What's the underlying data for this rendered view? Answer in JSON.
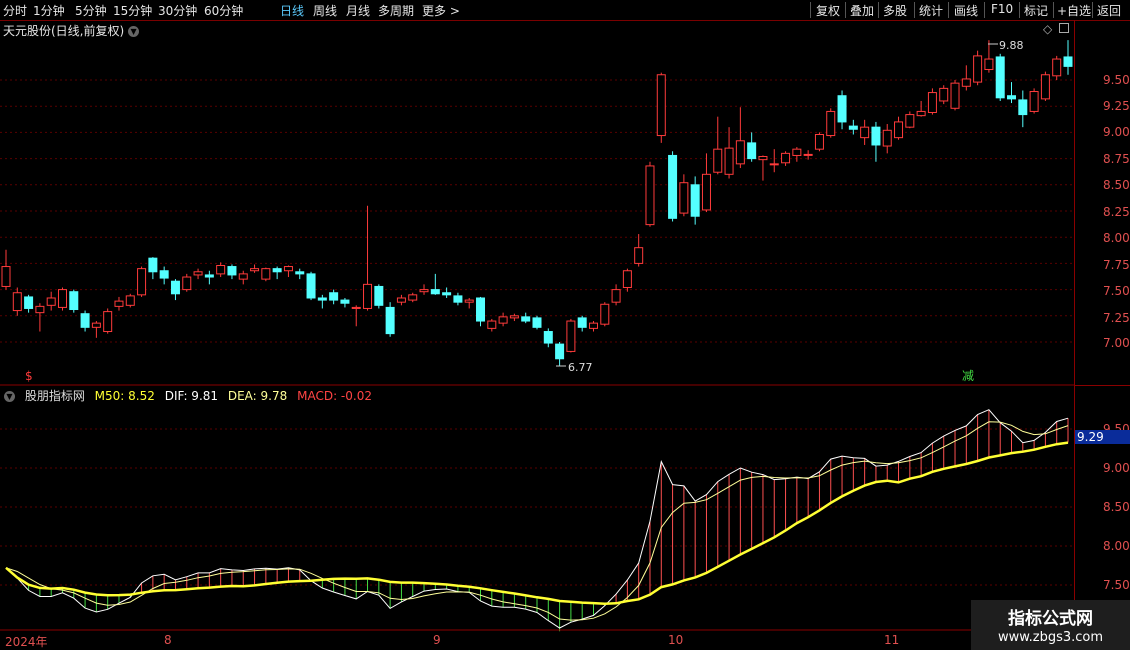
{
  "toolbar": {
    "periods": [
      "分时",
      "1分钟",
      "5分钟",
      "15分钟",
      "30分钟",
      "60分钟",
      "日线",
      "周线",
      "月线",
      "多周期",
      "更多 >"
    ],
    "active_period": "日线",
    "right_buttons": [
      "复权",
      "叠加",
      "多股",
      "统计",
      "画线",
      "F10",
      "标记",
      "+自选",
      "返回"
    ]
  },
  "main_chart": {
    "title": "天元股份(日线,前复权)",
    "high_label": "9.88",
    "low_label": "6.77",
    "marker_left": "$",
    "marker_right": "减",
    "price_axis": [
      "9.50",
      "9.25",
      "9.00",
      "8.75",
      "8.50",
      "8.25",
      "8.00",
      "7.75",
      "7.50",
      "7.25",
      "7.00"
    ]
  },
  "indicator": {
    "name": "股朋指标网",
    "m50_label": "M50: 8.52",
    "dif_label": "DIF: 9.81",
    "dea_label": "DEA: 9.78",
    "macd_label": "MACD: -0.02",
    "axis": [
      "9.50",
      "9.00",
      "8.50",
      "8.00",
      "7.50"
    ],
    "current_value": "9.29"
  },
  "date_axis": [
    "2024年",
    "8",
    "9",
    "10",
    "11"
  ],
  "watermark": {
    "title": "指标公式网",
    "url": "www.zbgs3.com"
  },
  "colors": {
    "up": "#ff3b3b",
    "down": "#54ffff",
    "m50": "#ffff33",
    "dif": "#ffffff",
    "dea": "#ffff99",
    "grid": "#7a0000"
  },
  "chart_data": {
    "type": "candlestick",
    "candles": [
      [
        7.53,
        7.72,
        7.88,
        7.5
      ],
      [
        7.3,
        7.47,
        7.52,
        7.25
      ],
      [
        7.43,
        7.32,
        7.45,
        7.28
      ],
      [
        7.28,
        7.34,
        7.37,
        7.1
      ],
      [
        7.35,
        7.42,
        7.48,
        7.3
      ],
      [
        7.33,
        7.5,
        7.52,
        7.3
      ],
      [
        7.48,
        7.31,
        7.5,
        7.28
      ],
      [
        7.27,
        7.14,
        7.3,
        7.1
      ],
      [
        7.14,
        7.18,
        7.2,
        7.04
      ],
      [
        7.1,
        7.29,
        7.32,
        7.08
      ],
      [
        7.34,
        7.39,
        7.43,
        7.3
      ],
      [
        7.35,
        7.44,
        7.46,
        7.33
      ],
      [
        7.45,
        7.7,
        7.72,
        7.43
      ],
      [
        7.8,
        7.67,
        7.81,
        7.6
      ],
      [
        7.68,
        7.61,
        7.72,
        7.55
      ],
      [
        7.58,
        7.46,
        7.6,
        7.4
      ],
      [
        7.5,
        7.62,
        7.65,
        7.48
      ],
      [
        7.64,
        7.67,
        7.7,
        7.6
      ],
      [
        7.64,
        7.62,
        7.68,
        7.55
      ],
      [
        7.65,
        7.73,
        7.76,
        7.62
      ],
      [
        7.72,
        7.64,
        7.74,
        7.6
      ],
      [
        7.6,
        7.65,
        7.68,
        7.55
      ],
      [
        7.68,
        7.7,
        7.74,
        7.66
      ],
      [
        7.6,
        7.7,
        7.71,
        7.58
      ],
      [
        7.7,
        7.67,
        7.72,
        7.6
      ],
      [
        7.68,
        7.72,
        7.73,
        7.62
      ],
      [
        7.67,
        7.65,
        7.7,
        7.6
      ],
      [
        7.65,
        7.42,
        7.67,
        7.4
      ],
      [
        7.42,
        7.4,
        7.45,
        7.32
      ],
      [
        7.47,
        7.4,
        7.5,
        7.36
      ],
      [
        7.4,
        7.37,
        7.42,
        7.33
      ],
      [
        7.32,
        7.33,
        7.35,
        7.15
      ],
      [
        7.32,
        7.55,
        8.3,
        7.3
      ],
      [
        7.53,
        7.35,
        7.55,
        7.32
      ],
      [
        7.33,
        7.08,
        7.38,
        7.05
      ],
      [
        7.38,
        7.42,
        7.45,
        7.35
      ],
      [
        7.4,
        7.45,
        7.47,
        7.38
      ],
      [
        7.48,
        7.5,
        7.55,
        7.45
      ],
      [
        7.5,
        7.46,
        7.65,
        7.45
      ],
      [
        7.47,
        7.45,
        7.52,
        7.42
      ],
      [
        7.44,
        7.38,
        7.47,
        7.35
      ],
      [
        7.38,
        7.4,
        7.42,
        7.32
      ],
      [
        7.42,
        7.2,
        7.43,
        7.15
      ],
      [
        7.13,
        7.2,
        7.22,
        7.1
      ],
      [
        7.18,
        7.24,
        7.28,
        7.15
      ],
      [
        7.23,
        7.25,
        7.27,
        7.2
      ],
      [
        7.24,
        7.2,
        7.28,
        7.18
      ],
      [
        7.23,
        7.14,
        7.25,
        7.12
      ],
      [
        7.1,
        6.99,
        7.13,
        6.95
      ],
      [
        6.98,
        6.84,
        7.0,
        6.77
      ],
      [
        6.91,
        7.2,
        7.22,
        6.9
      ],
      [
        7.23,
        7.14,
        7.25,
        7.1
      ],
      [
        7.13,
        7.18,
        7.2,
        7.1
      ],
      [
        7.17,
        7.36,
        7.38,
        7.15
      ],
      [
        7.38,
        7.5,
        7.55,
        7.35
      ],
      [
        7.52,
        7.68,
        7.7,
        7.48
      ],
      [
        7.75,
        7.9,
        8.03,
        7.72
      ],
      [
        8.12,
        8.68,
        8.72,
        8.1
      ],
      [
        8.97,
        9.55,
        9.57,
        8.9
      ],
      [
        8.78,
        8.18,
        8.82,
        8.15
      ],
      [
        8.23,
        8.52,
        8.6,
        8.2
      ],
      [
        8.5,
        8.2,
        8.58,
        8.12
      ],
      [
        8.26,
        8.6,
        8.8,
        8.24
      ],
      [
        8.62,
        8.84,
        9.15,
        8.6
      ],
      [
        8.6,
        8.85,
        9.05,
        8.56
      ],
      [
        8.7,
        8.92,
        9.24,
        8.66
      ],
      [
        8.9,
        8.75,
        9.0,
        8.72
      ],
      [
        8.74,
        8.77,
        8.78,
        8.54
      ],
      [
        8.7,
        8.7,
        8.84,
        8.62
      ],
      [
        8.71,
        8.8,
        8.82,
        8.68
      ],
      [
        8.78,
        8.84,
        8.86,
        8.72
      ],
      [
        8.79,
        8.79,
        8.83,
        8.74
      ],
      [
        8.84,
        8.98,
        9.0,
        8.82
      ],
      [
        8.97,
        9.2,
        9.23,
        8.95
      ],
      [
        9.35,
        9.1,
        9.4,
        9.03
      ],
      [
        9.06,
        9.03,
        9.12,
        8.98
      ],
      [
        8.95,
        9.05,
        9.12,
        8.88
      ],
      [
        9.05,
        8.88,
        9.1,
        8.72
      ],
      [
        8.87,
        9.02,
        9.08,
        8.8
      ],
      [
        8.95,
        9.1,
        9.15,
        8.93
      ],
      [
        9.05,
        9.17,
        9.2,
        9.04
      ],
      [
        9.16,
        9.2,
        9.3,
        9.15
      ],
      [
        9.19,
        9.38,
        9.42,
        9.17
      ],
      [
        9.3,
        9.42,
        9.45,
        9.27
      ],
      [
        9.23,
        9.47,
        9.5,
        9.21
      ],
      [
        9.44,
        9.51,
        9.64,
        9.4
      ],
      [
        9.48,
        9.73,
        9.78,
        9.45
      ],
      [
        9.6,
        9.7,
        9.88,
        9.57
      ],
      [
        9.72,
        9.33,
        9.75,
        9.3
      ],
      [
        9.35,
        9.32,
        9.48,
        9.28
      ],
      [
        9.31,
        9.17,
        9.4,
        9.05
      ],
      [
        9.2,
        9.39,
        9.42,
        9.18
      ],
      [
        9.32,
        9.55,
        9.58,
        9.3
      ],
      [
        9.54,
        9.7,
        9.73,
        9.5
      ],
      [
        9.72,
        9.63,
        9.88,
        9.55
      ]
    ],
    "candle_fields": [
      "open",
      "close",
      "high",
      "low"
    ],
    "price_range": [
      6.75,
      10.0
    ]
  }
}
